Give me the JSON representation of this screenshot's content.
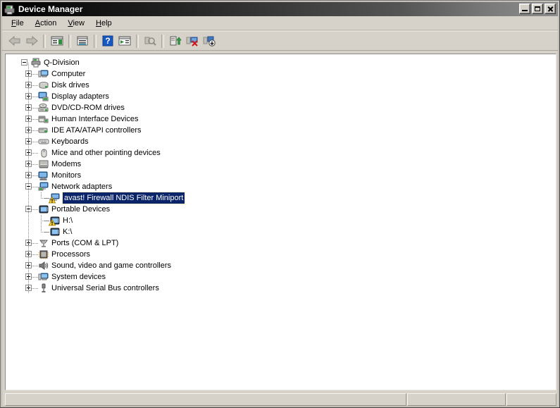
{
  "window": {
    "title": "Device Manager",
    "icon": "device-manager-icon",
    "controls": [
      {
        "name": "minimize-button",
        "glyph": "minimize"
      },
      {
        "name": "maximize-button",
        "glyph": "maximize"
      },
      {
        "name": "close-button",
        "glyph": "close"
      }
    ]
  },
  "menu": [
    {
      "label": "File",
      "accel": "F"
    },
    {
      "label": "Action",
      "accel": "A"
    },
    {
      "label": "View",
      "accel": "V"
    },
    {
      "label": "Help",
      "accel": "H"
    }
  ],
  "toolbar": [
    {
      "name": "back-button",
      "icon": "back-arrow-icon",
      "enabled": false
    },
    {
      "name": "forward-button",
      "icon": "forward-arrow-icon",
      "enabled": false
    },
    {
      "name": "separator-1",
      "icon": "separator",
      "enabled": false
    },
    {
      "name": "show-hide-console-tree-button",
      "icon": "console-tree-icon",
      "enabled": true
    },
    {
      "name": "separator-2",
      "icon": "separator",
      "enabled": false
    },
    {
      "name": "properties-button",
      "icon": "properties-icon",
      "enabled": true
    },
    {
      "name": "separator-3",
      "icon": "separator",
      "enabled": false
    },
    {
      "name": "help-button",
      "icon": "help-question-icon",
      "enabled": true
    },
    {
      "name": "show-hide-action-pane-button",
      "icon": "action-pane-icon",
      "enabled": true
    },
    {
      "name": "separator-4",
      "icon": "separator",
      "enabled": false
    },
    {
      "name": "scan-for-hardware-changes-button",
      "icon": "scan-hardware-icon",
      "enabled": false
    },
    {
      "name": "separator-5",
      "icon": "separator",
      "enabled": false
    },
    {
      "name": "update-driver-button",
      "icon": "update-driver-icon",
      "enabled": true
    },
    {
      "name": "uninstall-device-button",
      "icon": "uninstall-device-icon",
      "enabled": true
    },
    {
      "name": "disable-device-button",
      "icon": "disable-device-icon",
      "enabled": true
    }
  ],
  "tree": [
    {
      "label": "Q-Division",
      "depth": 0,
      "expander": "minus",
      "icon": "computer-root-icon",
      "selected": false,
      "warning": false
    },
    {
      "label": "Computer",
      "depth": 1,
      "expander": "plus",
      "icon": "computer-icon",
      "selected": false,
      "warning": false
    },
    {
      "label": "Disk drives",
      "depth": 1,
      "expander": "plus",
      "icon": "disk-drive-icon",
      "selected": false,
      "warning": false
    },
    {
      "label": "Display adapters",
      "depth": 1,
      "expander": "plus",
      "icon": "display-adapter-icon",
      "selected": false,
      "warning": false
    },
    {
      "label": "DVD/CD-ROM drives",
      "depth": 1,
      "expander": "plus",
      "icon": "dvd-drive-icon",
      "selected": false,
      "warning": false
    },
    {
      "label": "Human Interface Devices",
      "depth": 1,
      "expander": "plus",
      "icon": "hid-icon",
      "selected": false,
      "warning": false
    },
    {
      "label": "IDE ATA/ATAPI controllers",
      "depth": 1,
      "expander": "plus",
      "icon": "ide-controller-icon",
      "selected": false,
      "warning": false
    },
    {
      "label": "Keyboards",
      "depth": 1,
      "expander": "plus",
      "icon": "keyboard-icon",
      "selected": false,
      "warning": false
    },
    {
      "label": "Mice and other pointing devices",
      "depth": 1,
      "expander": "plus",
      "icon": "mouse-icon",
      "selected": false,
      "warning": false
    },
    {
      "label": "Modems",
      "depth": 1,
      "expander": "plus",
      "icon": "modem-icon",
      "selected": false,
      "warning": false
    },
    {
      "label": "Monitors",
      "depth": 1,
      "expander": "plus",
      "icon": "monitor-icon",
      "selected": false,
      "warning": false
    },
    {
      "label": "Network adapters",
      "depth": 1,
      "expander": "minus",
      "icon": "network-adapter-icon",
      "selected": false,
      "warning": false
    },
    {
      "label": "avast! Firewall NDIS Filter Miniport",
      "depth": 2,
      "expander": "none",
      "icon": "network-adapter-icon",
      "selected": true,
      "warning": true
    },
    {
      "label": "Portable Devices",
      "depth": 1,
      "expander": "minus",
      "icon": "portable-device-icon",
      "selected": false,
      "warning": false
    },
    {
      "label": "H:\\",
      "depth": 2,
      "expander": "none",
      "icon": "portable-device-icon",
      "selected": false,
      "warning": true
    },
    {
      "label": "K:\\",
      "depth": 2,
      "expander": "none",
      "icon": "portable-device-icon",
      "selected": false,
      "warning": false
    },
    {
      "label": "Ports (COM & LPT)",
      "depth": 1,
      "expander": "plus",
      "icon": "port-icon",
      "selected": false,
      "warning": false
    },
    {
      "label": "Processors",
      "depth": 1,
      "expander": "plus",
      "icon": "processor-icon",
      "selected": false,
      "warning": false
    },
    {
      "label": "Sound, video and game controllers",
      "depth": 1,
      "expander": "plus",
      "icon": "sound-controller-icon",
      "selected": false,
      "warning": false
    },
    {
      "label": "System devices",
      "depth": 1,
      "expander": "plus",
      "icon": "system-device-icon",
      "selected": false,
      "warning": false
    },
    {
      "label": "Universal Serial Bus controllers",
      "depth": 1,
      "expander": "plus",
      "icon": "usb-controller-icon",
      "selected": false,
      "warning": false
    }
  ],
  "statusbar": {
    "pane1": "",
    "pane2": "",
    "pane3": ""
  },
  "colors": {
    "selection": "#0a246a",
    "warning": "#ffd629",
    "window_face": "#d6d2ca",
    "tree_background": "#ffffff"
  }
}
